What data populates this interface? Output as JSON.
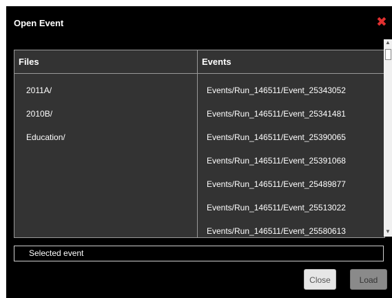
{
  "dialog": {
    "title": "Open Event",
    "close_icon": "close-x-icon",
    "accent_close_color": "#e03030"
  },
  "table": {
    "headers": {
      "files": "Files",
      "events": "Events"
    },
    "files": [
      "2011A/",
      "2010B/",
      "Education/"
    ],
    "events": [
      "Events/Run_146511/Event_25343052",
      "Events/Run_146511/Event_25341481",
      "Events/Run_146511/Event_25390065",
      "Events/Run_146511/Event_25391068",
      "Events/Run_146511/Event_25489877",
      "Events/Run_146511/Event_25513022",
      "Events/Run_146511/Event_25580613"
    ]
  },
  "selected": {
    "label": "Selected event"
  },
  "buttons": {
    "close": "Close",
    "load": "Load"
  }
}
